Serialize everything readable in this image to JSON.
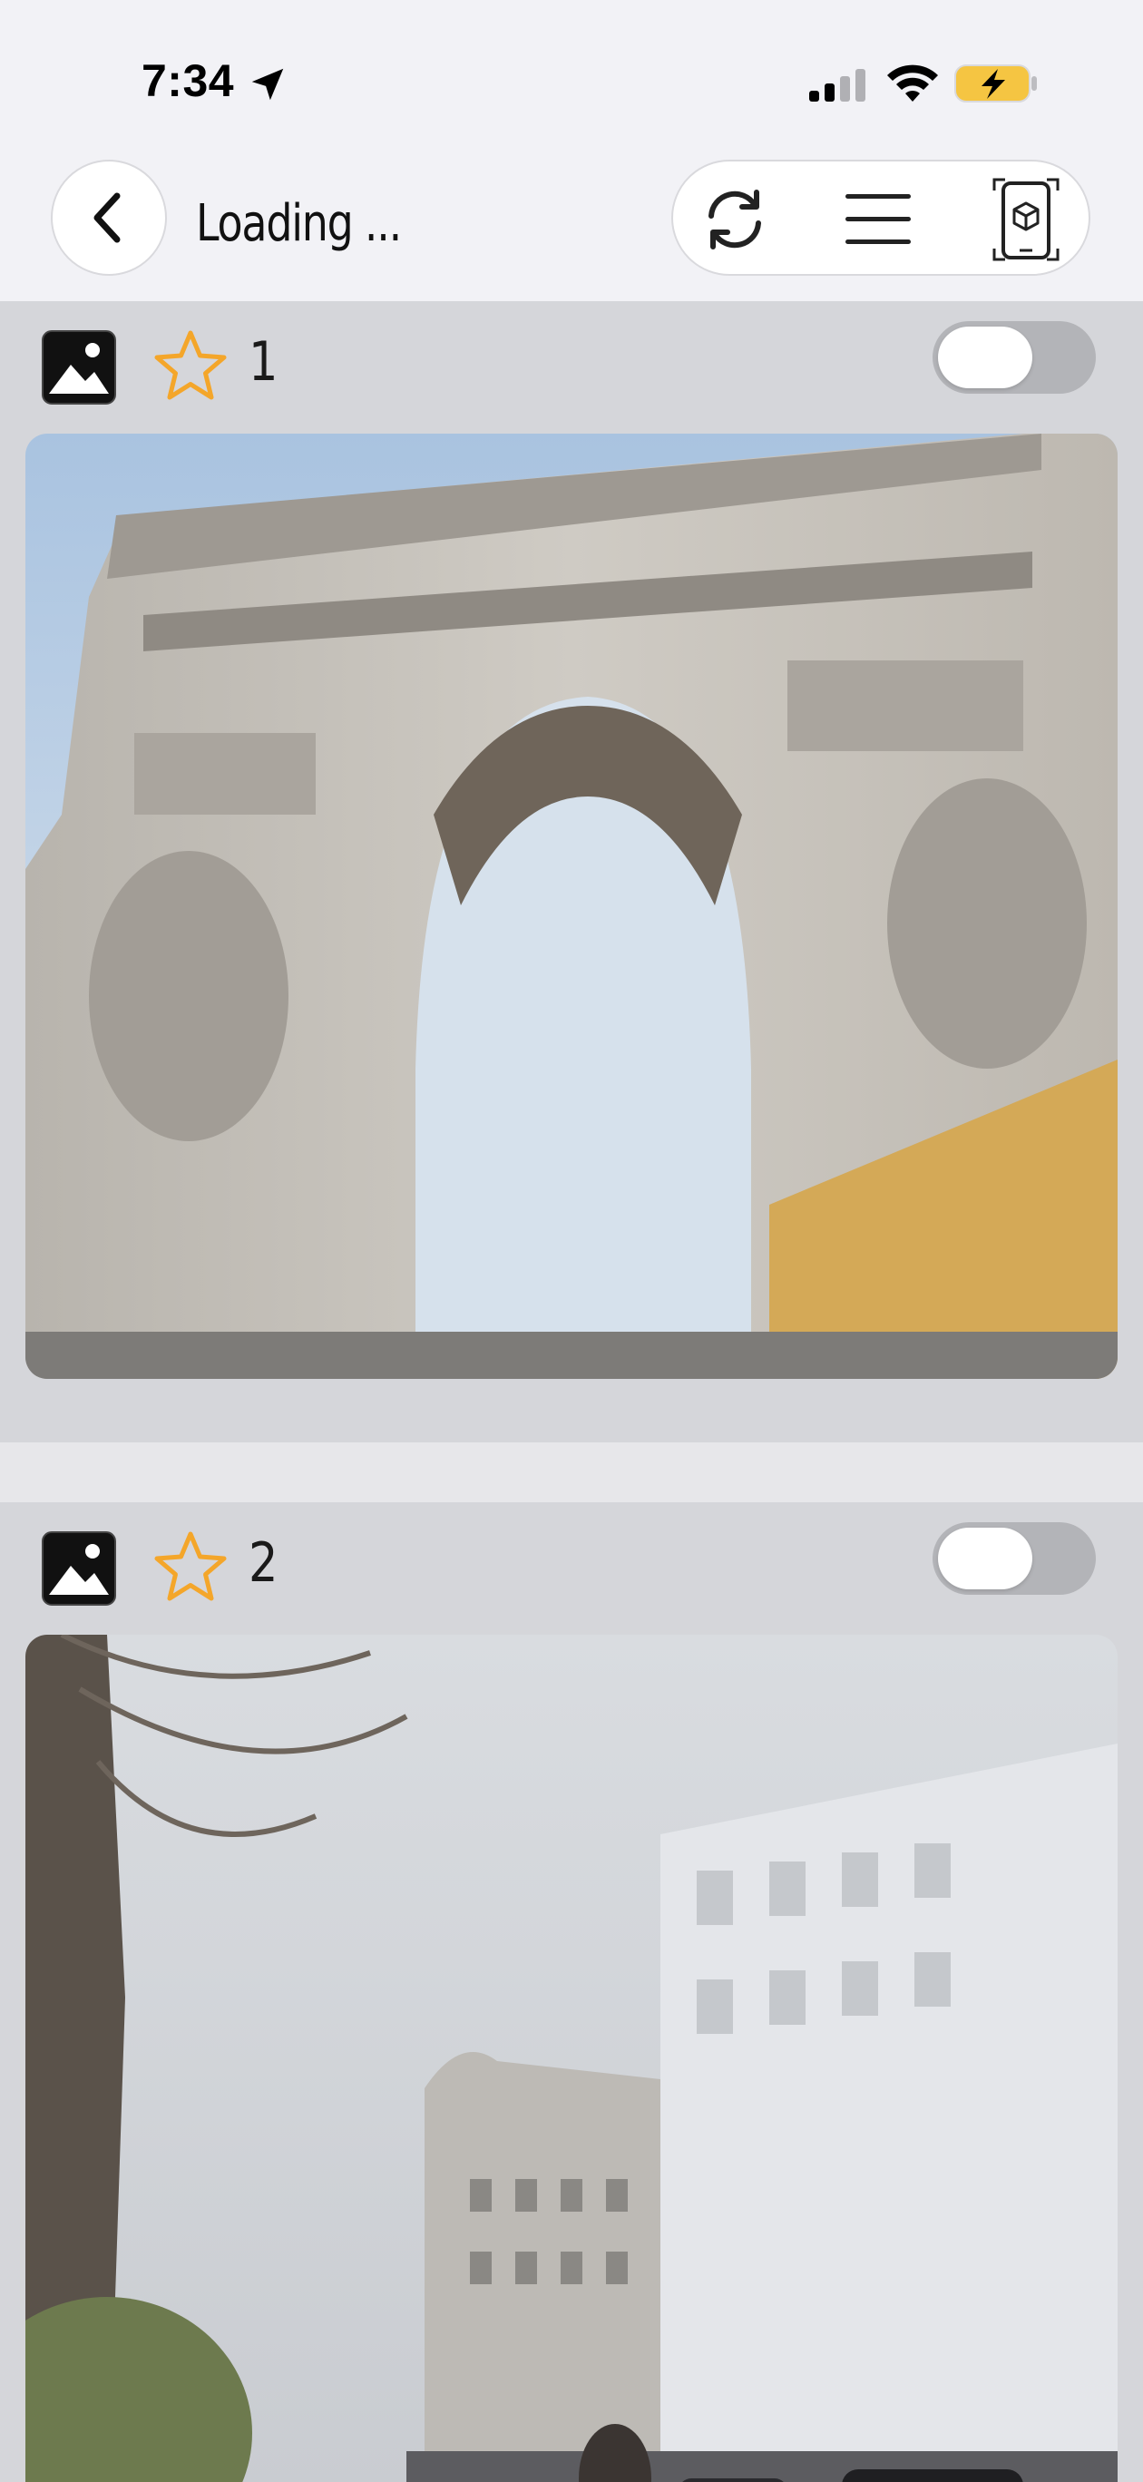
{
  "status_bar": {
    "time": "7:34",
    "icons": [
      "location-arrow-icon",
      "cellular-signal-icon",
      "wifi-icon",
      "battery-charging-icon"
    ],
    "battery_color": "#f5c542"
  },
  "nav": {
    "back_icon": "chevron-left-icon",
    "title": "Loading ...",
    "actions": [
      "refresh-icon",
      "hamburger-menu-icon",
      "device-ar-icon"
    ]
  },
  "feed": {
    "items": [
      {
        "index": "1",
        "type_icon": "photo-icon",
        "favorite_icon": "star-outline-icon",
        "toggle_on": false,
        "image_subject": "arch-photo"
      },
      {
        "index": "2",
        "type_icon": "photo-icon",
        "favorite_icon": "star-outline-icon",
        "toggle_on": false,
        "image_subject": "street-photo"
      }
    ]
  },
  "colors": {
    "background": "#f2f2f6",
    "feed_background": "#d5d6da",
    "star": "#f4a62a",
    "toggle_off": "#b3b4b8"
  }
}
